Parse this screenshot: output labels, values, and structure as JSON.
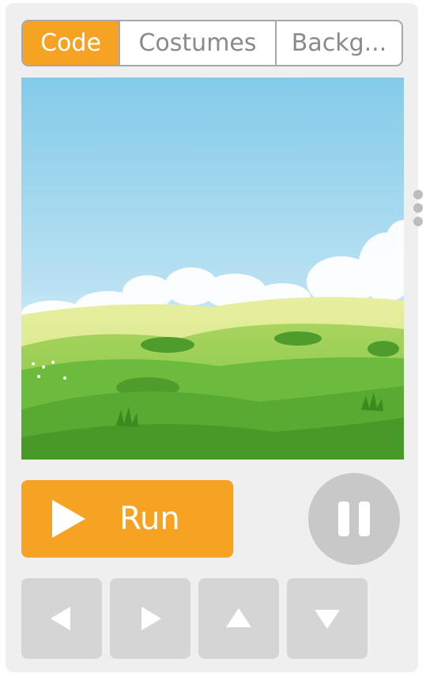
{
  "tabs": {
    "code": "Code",
    "costumes": "Costumes",
    "backgrounds": "Backg..."
  },
  "active_tab": "Code",
  "run": {
    "label": "Run"
  },
  "colors": {
    "accent": "#f6a323",
    "panel": "#efefef",
    "button_gray": "#d5d5d5",
    "pause_gray": "#c9c8c8",
    "sky_top": "#84cbe9",
    "grass": "#5fb23a"
  },
  "icons": {
    "run": "play-icon",
    "pause": "pause-icon",
    "left": "arrow-left-icon",
    "right": "arrow-right-icon",
    "up": "arrow-up-icon",
    "down": "arrow-down-icon"
  }
}
